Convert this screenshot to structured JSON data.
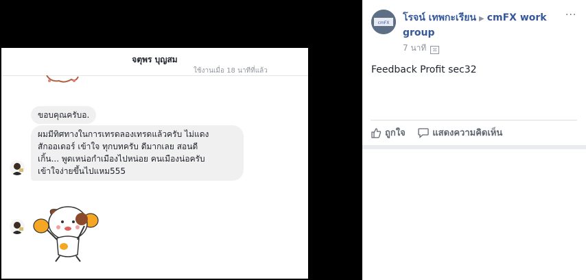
{
  "photo": {
    "chat_name": "จตุพร บุญสม",
    "status": "ใช้งานเมื่อ 18 นาทีที่แล้ว",
    "messages": [
      "ขอบคุณครับอ.",
      [
        "ผมมีทิศทางในการเทรดลองเทรดแล้วครับ ไม่แดง",
        "สักออเดอร์  เข้าใจ ทุกบทครับ ดีมากเลย สอนดี",
        "เกิ้น... พูดเหน่อกำเมืองไปหน่อย คนเมืองน่อครับ",
        "เข้าใจง่ายขึ้นไปแหม555"
      ]
    ]
  },
  "post": {
    "author": "โรจน์ เทพกะเรียน",
    "group": "cmFX work group",
    "time": "7 นาที",
    "more_icon": "···",
    "text": "Feedback Profit sec32",
    "like_label": "ถูกใจ",
    "comment_label": "แสดงความคิดเห็น"
  }
}
